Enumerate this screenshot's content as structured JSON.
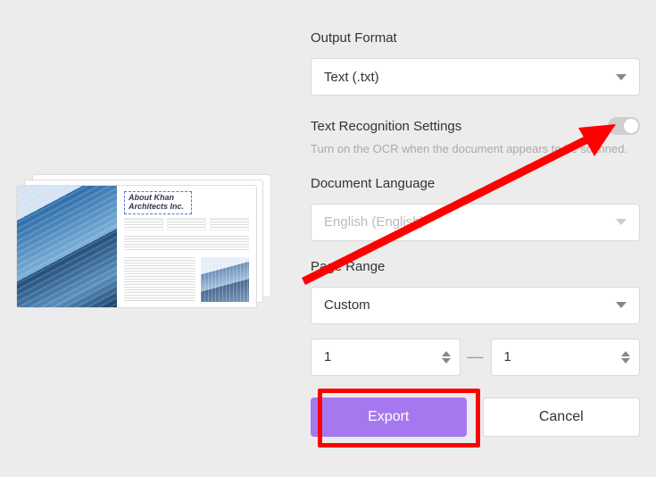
{
  "preview": {
    "doc_title_line1": "About Khan",
    "doc_title_line2": "Architects Inc."
  },
  "form": {
    "output_format": {
      "label": "Output Format",
      "value": "Text (.txt)"
    },
    "ocr": {
      "label": "Text Recognition Settings",
      "hint": "Turn on the OCR when the document appears to be scanned.",
      "enabled": false
    },
    "doc_lang": {
      "label": "Document Language",
      "value": "English (English)"
    },
    "page_range": {
      "label": "Page Range",
      "mode": "Custom",
      "from": "1",
      "to": "1",
      "sep": "—"
    },
    "buttons": {
      "export": "Export",
      "cancel": "Cancel"
    }
  }
}
